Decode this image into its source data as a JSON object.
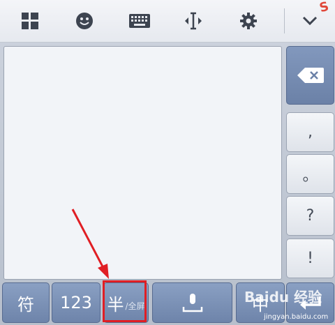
{
  "toolbar": {
    "icons": [
      "layout-grid-icon",
      "emoji-icon",
      "keyboard-icon",
      "cursor-move-icon",
      "gear-icon",
      "chevron-down-icon"
    ]
  },
  "side_keys": [
    {
      "name": "comma-key",
      "label": ","
    },
    {
      "name": "period-key",
      "label": "。"
    },
    {
      "name": "question-key",
      "label": "?"
    },
    {
      "name": "exclamation-key",
      "label": "!"
    }
  ],
  "bottom_keys": {
    "symbols": "符",
    "numbers": "123",
    "half_width": "半",
    "full_screen": "/全屏",
    "chinese": "中"
  },
  "watermark": {
    "text": "Baidu 经验",
    "url": "jingyan.baidu.com"
  },
  "colors": {
    "key_blue": "#7b91b7",
    "highlight": "#e01e24"
  }
}
